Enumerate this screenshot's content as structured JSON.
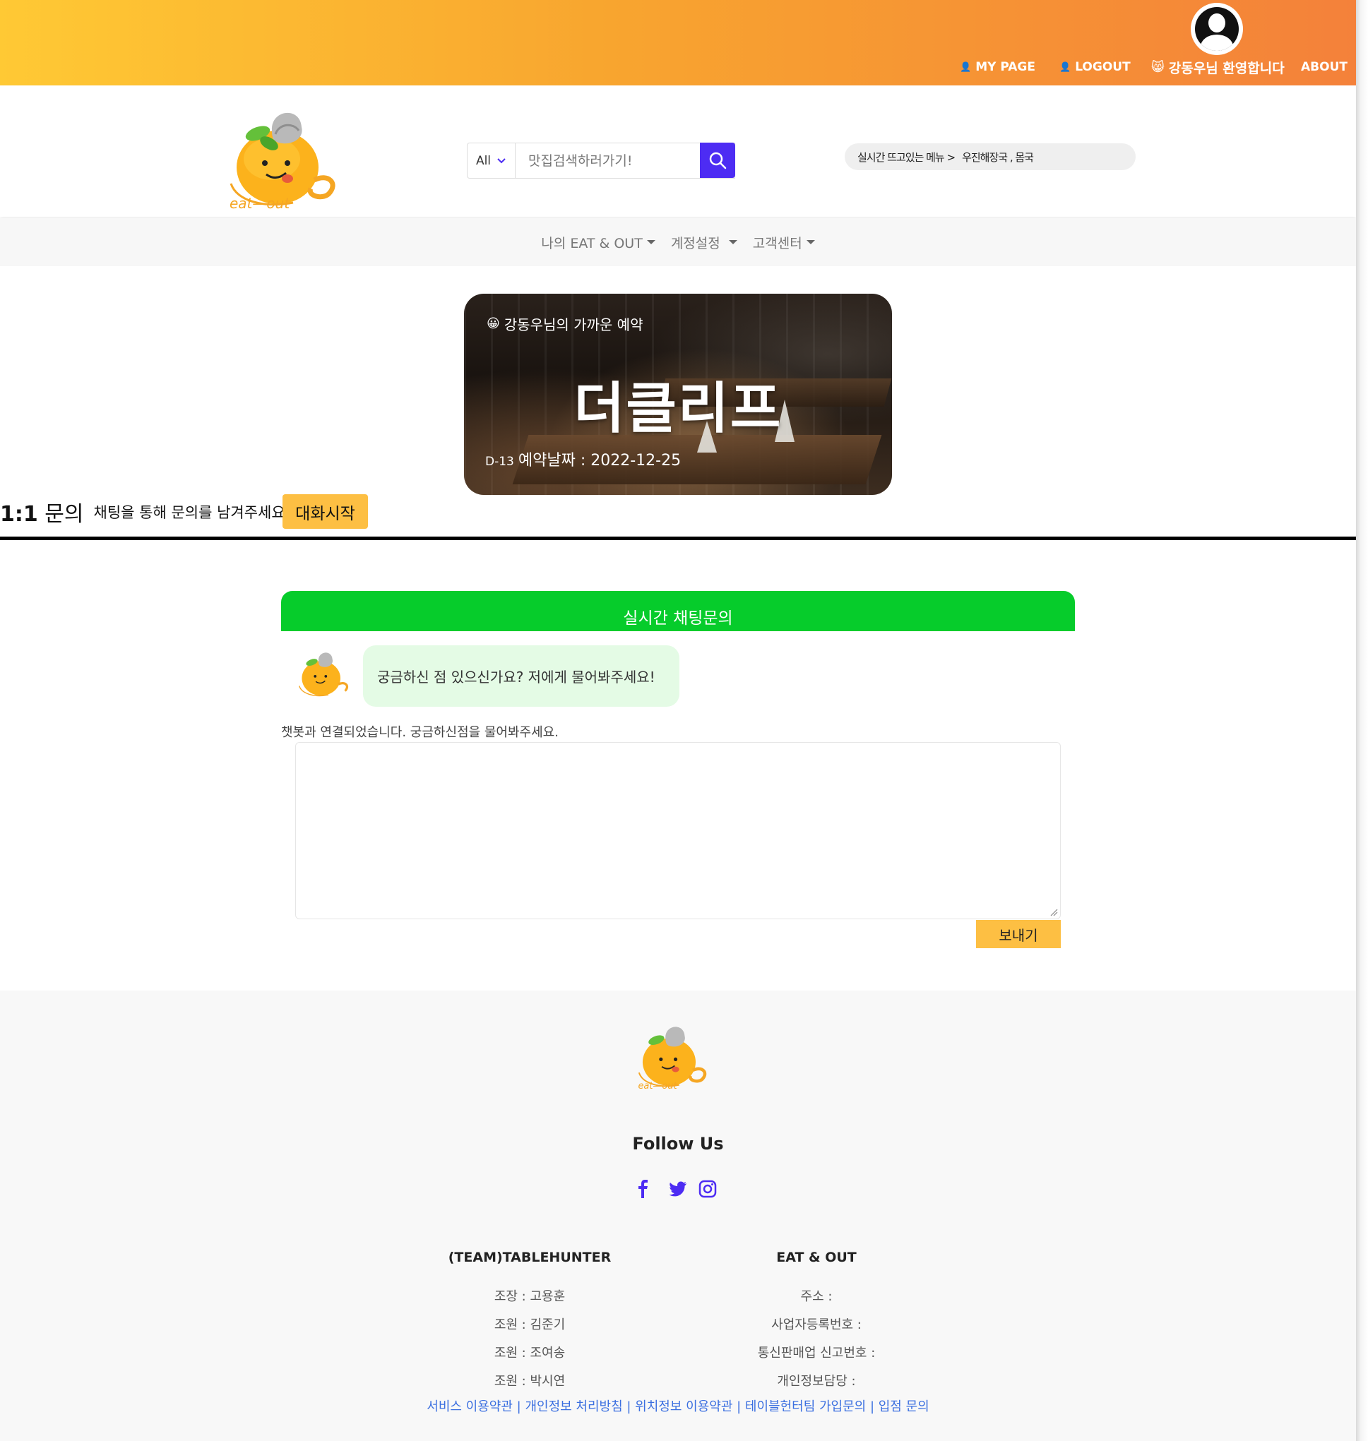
{
  "topnav": {
    "mypage": "MY PAGE",
    "logout": "LOGOUT",
    "welcome": "강동우님 환영합니다",
    "about": "ABOUT"
  },
  "search": {
    "category": "All",
    "placeholder": "맛집검색하러가기!"
  },
  "trending": {
    "label": "실시간 뜨고있는 메뉴 >",
    "items": "우진해장국 , 몸국"
  },
  "subnav": {
    "items": [
      {
        "label": "나의 EAT & OUT"
      },
      {
        "label": "계정설정"
      },
      {
        "label": "고객센터"
      }
    ]
  },
  "reservation": {
    "label": "강동우님의 가까운 예약",
    "restaurant": "더클리프",
    "dday": "D-13",
    "date_text": "예약날짜 : 2022-12-25"
  },
  "inquiry": {
    "title_bold": "1:1",
    "title_rest": "문의",
    "description": "채팅을 통해 문의를 남겨주세요.",
    "start_button": "대화시작"
  },
  "chat": {
    "header": "실시간 채팅문의",
    "bot_message": "궁금하신 점 있으신가요? 저에게 물어봐주세요!",
    "status": "챗봇과 연결되었습니다. 궁금하신점을 물어봐주세요.",
    "send_button": "보내기"
  },
  "footer": {
    "follow": "Follow Us",
    "team": {
      "title": "(TEAM)TABLEHUNTER",
      "rows": [
        "조장 : 고용훈",
        "조원 : 김준기",
        "조원 : 조여송",
        "조원 : 박시연"
      ]
    },
    "company": {
      "title": "EAT & OUT",
      "rows": [
        "주소 :",
        "사업자등록번호 :",
        "통신판매업 신고번호 :",
        "개인정보담당 :"
      ]
    },
    "links": [
      "서비스 이용약관",
      "개인정보 처리방침",
      "위치정보 이용약관",
      "테이블헌터팀 가입문의",
      "입점 문의"
    ]
  },
  "colors": {
    "topbar_start": "#ffc934",
    "topbar_end": "#f4813a",
    "search_button": "#4d2cf3",
    "chat_header": "#06cc2b",
    "accent_button": "#fdbf43",
    "social_icon": "#4d2cf3",
    "footer_link": "#3b6fe0"
  }
}
